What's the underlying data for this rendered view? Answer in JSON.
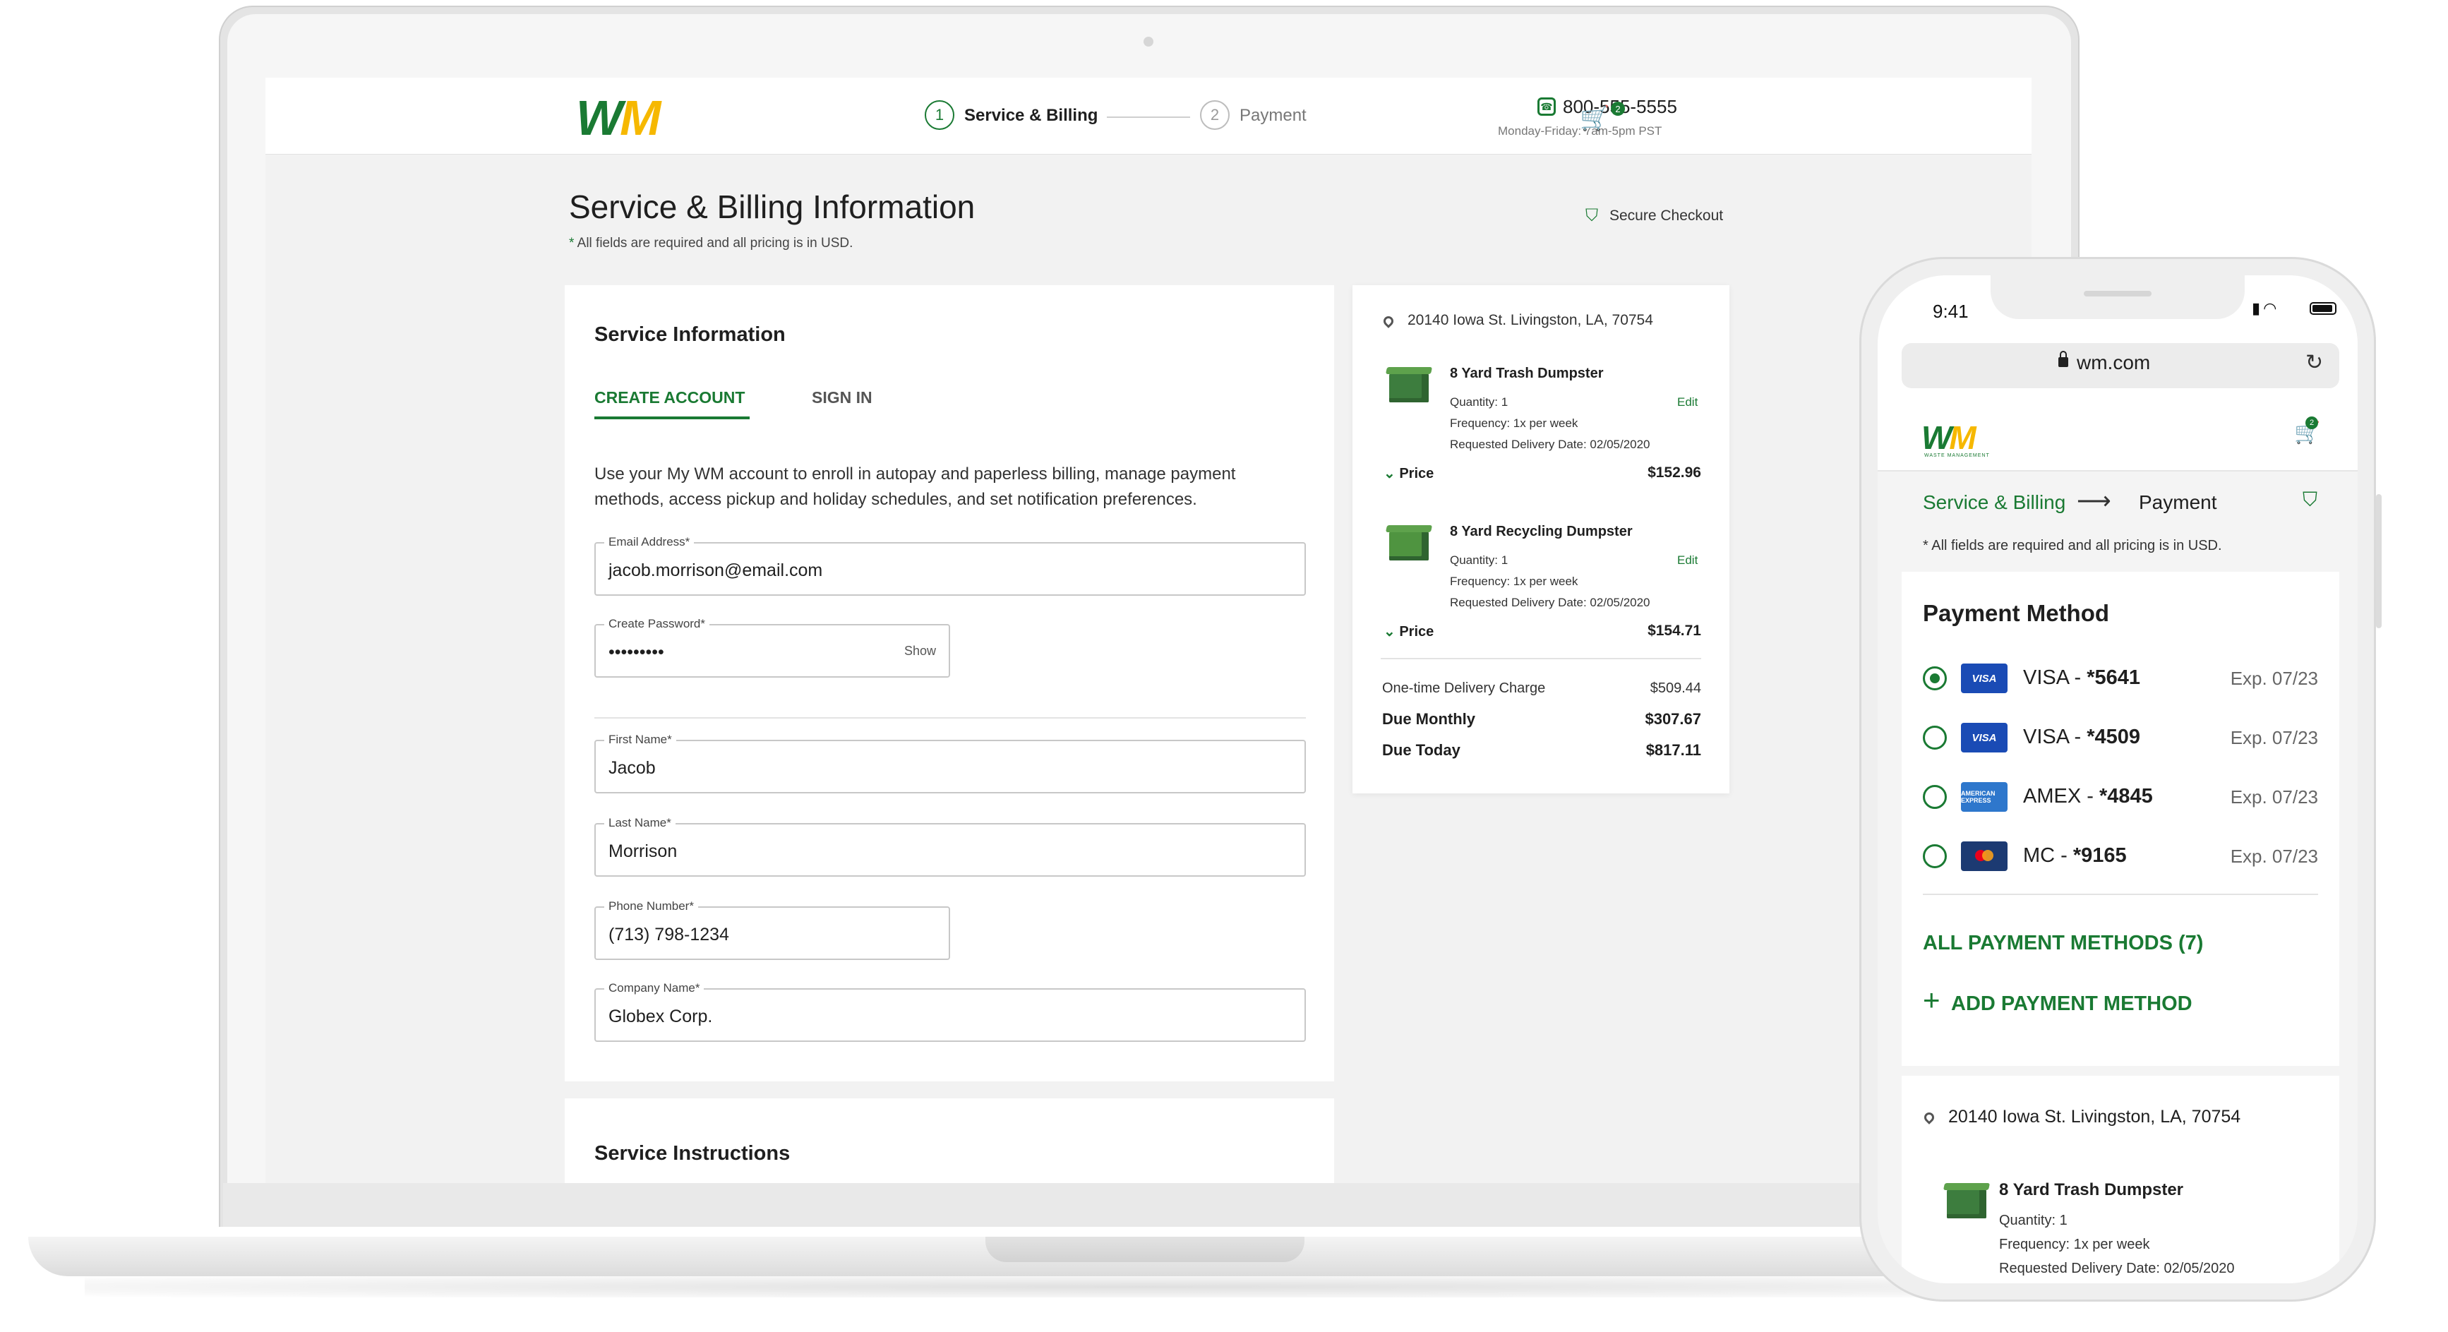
{
  "brand": {
    "logo_w": "W",
    "logo_m": "M",
    "logo_sub": "WASTE MANAGEMENT",
    "green": "#1a7a33",
    "yellow": "#f6b800"
  },
  "header": {
    "step1_number": "1",
    "step1_label": "Service & Billing",
    "step2_number": "2",
    "step2_label": "Payment",
    "phone_number": "800-555-5555",
    "phone_hours": "Monday-Friday: 7am-5pm PST",
    "cart_count": "2",
    "phone_icon": "phone-icon",
    "cart_icon": "cart-icon"
  },
  "page": {
    "title": "Service & Billing Information",
    "required_star": "*",
    "required_note": "All fields are required and all pricing is in USD.",
    "secure_label": "Secure Checkout"
  },
  "service_info": {
    "heading": "Service Information",
    "tab_create": "CREATE ACCOUNT",
    "tab_signin": "SIGN IN",
    "intro": "Use your My WM account to enroll in autopay and paperless billing, manage payment methods, access pickup and holiday schedules, and set notification preferences.",
    "fields": {
      "email_label": "Email Address*",
      "email_value": "jacob.morrison@email.com",
      "password_label": "Create Password*",
      "password_value": "•••••••••",
      "password_show": "Show",
      "first_label": "First Name*",
      "first_value": "Jacob",
      "last_label": "Last Name*",
      "last_value": "Morrison",
      "phone_label": "Phone Number*",
      "phone_value": "(713) 798-1234",
      "company_label": "Company Name*",
      "company_value": "Globex Corp."
    }
  },
  "service_instructions": {
    "heading": "Service Instructions"
  },
  "summary": {
    "address": "20140 Iowa St. Livingston, LA, 70754",
    "items": [
      {
        "title": "8 Yard Trash Dumpster",
        "quantity": "Quantity: 1",
        "frequency": "Frequency: 1x per week",
        "delivery": "Requested Delivery Date: 02/05/2020",
        "edit": "Edit",
        "price_label": "Price",
        "price": "$152.96"
      },
      {
        "title": "8 Yard Recycling Dumpster",
        "quantity": "Quantity: 1",
        "frequency": "Frequency: 1x per week",
        "delivery": "Requested Delivery Date: 02/05/2020",
        "edit": "Edit",
        "price_label": "Price",
        "price": "$154.71"
      }
    ],
    "delivery_charge_label": "One-time Delivery Charge",
    "delivery_charge": "$509.44",
    "due_monthly_label": "Due Monthly",
    "due_monthly": "$307.67",
    "due_today_label": "Due Today",
    "due_today": "$817.11"
  },
  "mobile": {
    "time": "9:41",
    "url": "wm.com",
    "step1": "Service & Billing",
    "step2": "Payment",
    "cart_count": "2",
    "required_note": "* All fields are required and all pricing is in USD.",
    "payment_heading": "Payment Method",
    "methods": [
      {
        "brand": "VISA",
        "label": "VISA - ",
        "last4": "*5641",
        "exp": "Exp. 07/23",
        "selected": true
      },
      {
        "brand": "VISA",
        "label": "VISA - ",
        "last4": "*4509",
        "exp": "Exp. 07/23",
        "selected": false
      },
      {
        "brand": "AMERICAN EXPRESS",
        "label": "AMEX - ",
        "last4": "*4845",
        "exp": "Exp. 07/23",
        "selected": false
      },
      {
        "brand": "MC",
        "label": "MC - ",
        "last4": "*9165",
        "exp": "Exp. 07/23",
        "selected": false
      }
    ],
    "all_methods": "ALL PAYMENT METHODS (7)",
    "add_method": "ADD PAYMENT METHOD",
    "address": "20140 Iowa St. Livingston, LA, 70754",
    "item_title": "8 Yard Trash Dumpster",
    "item_quantity": "Quantity: 1",
    "item_frequency": "Frequency: 1x per week",
    "item_delivery": "Requested Delivery Date: 02/05/2020"
  }
}
